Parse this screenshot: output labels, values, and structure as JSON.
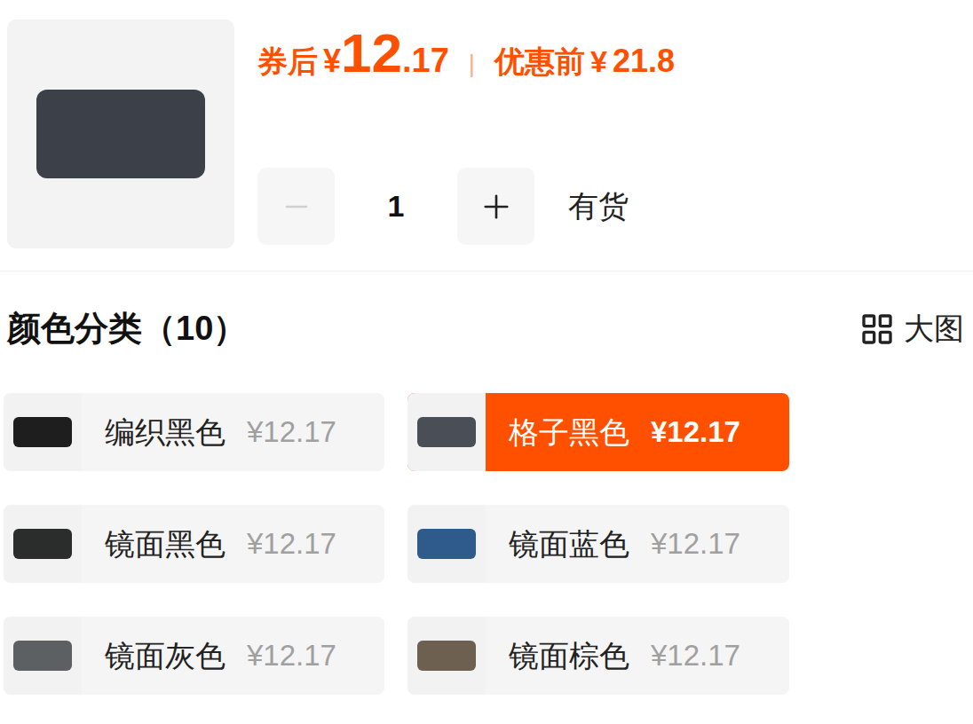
{
  "product": {
    "image": "checkered crossbody bag photo"
  },
  "price": {
    "after_label": "券后",
    "currency": "¥",
    "integer": "12",
    "decimal": ".17",
    "separator": "|",
    "original_label": "优惠前",
    "original_currency": "¥",
    "original_amount": "21.8"
  },
  "quantity": {
    "value": "1",
    "minus_disabled": true,
    "stock": "有货"
  },
  "section": {
    "title": "颜色分类（10）",
    "view_toggle": "大图"
  },
  "options": [
    {
      "name": "编织黑色",
      "price": "¥12.17",
      "selected": false,
      "color": "#1e1e1e"
    },
    {
      "name": "格子黑色",
      "price": "¥12.17",
      "selected": true,
      "color": "#4a4f57"
    },
    {
      "name": "镜面黑色",
      "price": "¥12.17",
      "selected": false,
      "color": "#2a2d2c"
    },
    {
      "name": "镜面蓝色",
      "price": "¥12.17",
      "selected": false,
      "color": "#2f5b8c"
    },
    {
      "name": "镜面灰色",
      "price": "¥12.17",
      "selected": false,
      "color": "#5d6062"
    },
    {
      "name": "镜面棕色",
      "price": "¥12.17",
      "selected": false,
      "color": "#6e6050"
    }
  ]
}
